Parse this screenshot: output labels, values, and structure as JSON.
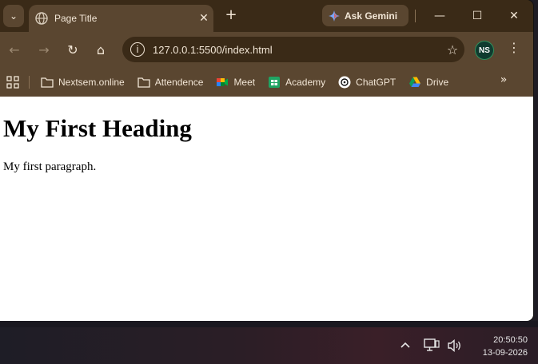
{
  "browser": {
    "tab": {
      "title": "Page Title",
      "close_glyph": "✕"
    },
    "new_tab_glyph": "+",
    "gemini_label": "Ask Gemini",
    "window": {
      "minimize": "—",
      "maximize": "☐",
      "close": "✕"
    },
    "toolbar": {
      "back": "←",
      "forward": "→",
      "reload": "↻",
      "home": "⌂",
      "menu": "⋮"
    },
    "omnibox": {
      "url": "127.0.0.1:5500/index.html",
      "star": "☆"
    },
    "profile_initials": "NS",
    "bookmarks": [
      {
        "label": "Nextsem.online",
        "icon": "folder-icon"
      },
      {
        "label": "Attendence",
        "icon": "folder-icon"
      },
      {
        "label": "Meet",
        "icon": "meet-icon"
      },
      {
        "label": "Academy",
        "icon": "sheets-icon"
      },
      {
        "label": "ChatGPT",
        "icon": "chatgpt-icon"
      },
      {
        "label": "Drive",
        "icon": "drive-icon"
      }
    ],
    "bookmarks_more": "»"
  },
  "page": {
    "heading": "My First Heading",
    "paragraph": "My first paragraph."
  },
  "taskbar": {
    "chevron": "^",
    "time": "20:50:50",
    "date": "13-09-2026"
  },
  "colors": {
    "frame": "#3a2a17",
    "toolbar": "#5a4630",
    "text_light": "#f2e6d6"
  }
}
